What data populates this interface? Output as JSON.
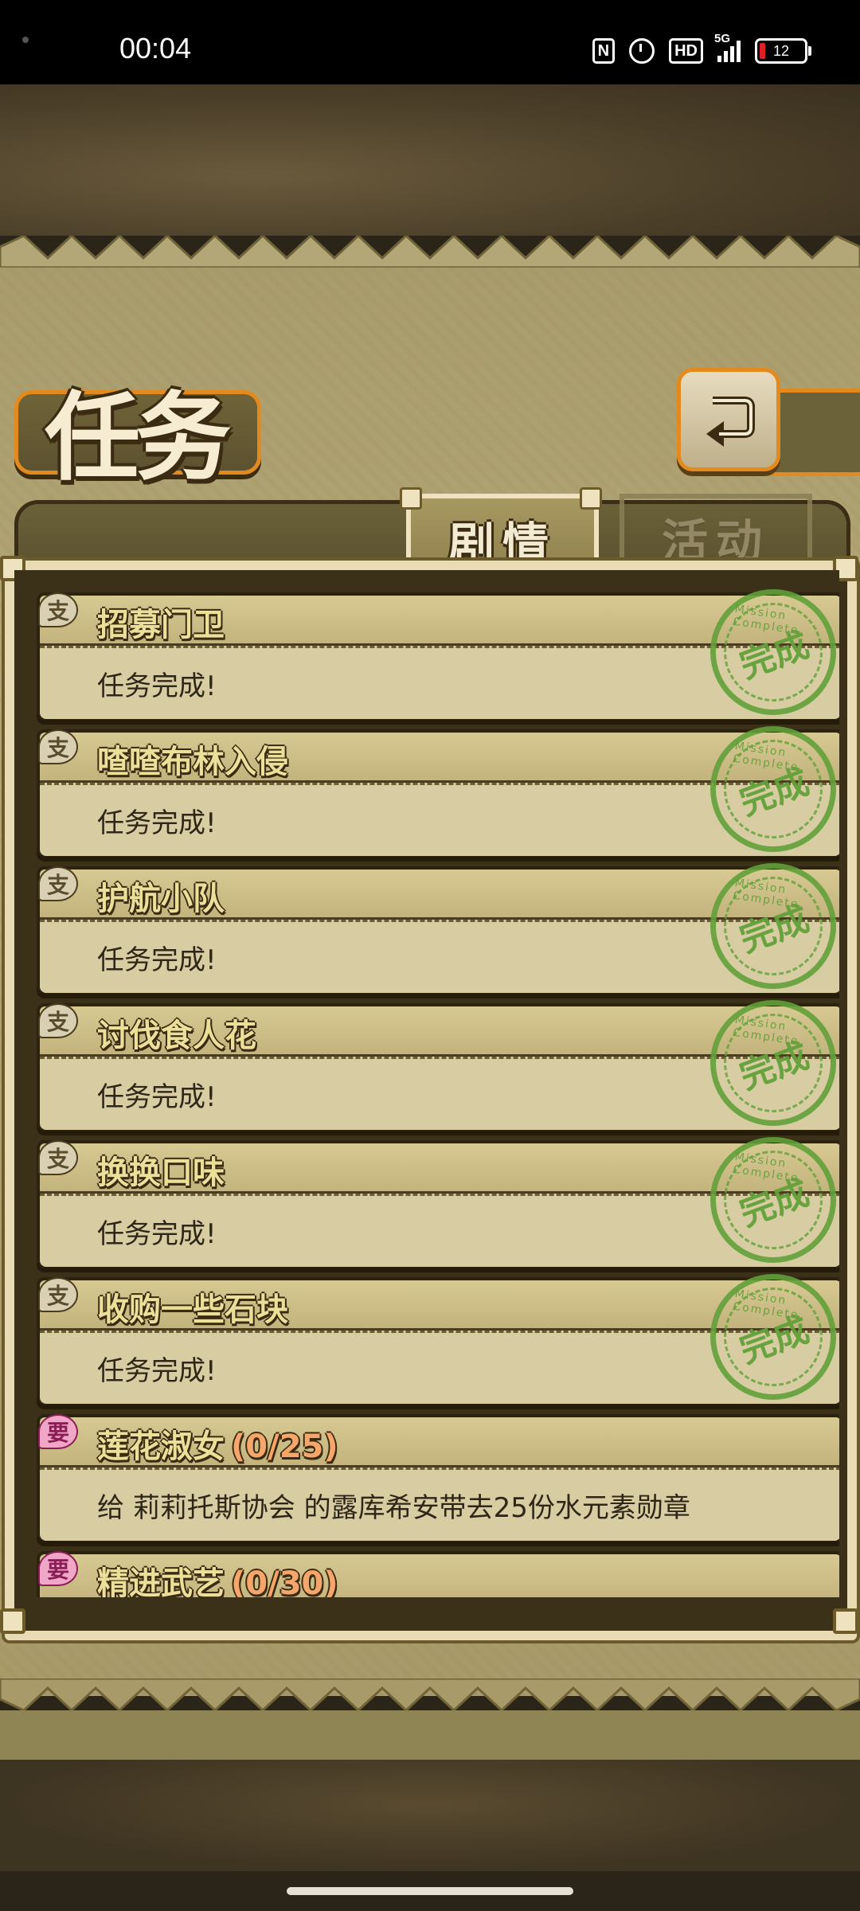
{
  "status_bar": {
    "time": "00:04",
    "network": "5G",
    "hd_label": "HD",
    "battery": "12"
  },
  "header": {
    "title": "任务",
    "back_icon": "return-arrow-icon"
  },
  "tabs": [
    {
      "label": "剧情",
      "active": true
    },
    {
      "label": "活动",
      "active": false
    }
  ],
  "quests": [
    {
      "badge": "支",
      "type": "side",
      "title": "招募门卫",
      "progress": "",
      "desc": "任务完成!",
      "completed": true
    },
    {
      "badge": "支",
      "type": "side",
      "title": "喳喳布林入侵",
      "progress": "",
      "desc": "任务完成!",
      "completed": true
    },
    {
      "badge": "支",
      "type": "side",
      "title": "护航小队",
      "progress": "",
      "desc": "任务完成!",
      "completed": true
    },
    {
      "badge": "支",
      "type": "side",
      "title": "讨伐食人花",
      "progress": "",
      "desc": "任务完成!",
      "completed": true
    },
    {
      "badge": "支",
      "type": "side",
      "title": "换换口味",
      "progress": "",
      "desc": "任务完成!",
      "completed": true
    },
    {
      "badge": "支",
      "type": "side",
      "title": "收购一些石块",
      "progress": "",
      "desc": "任务完成!",
      "completed": true
    },
    {
      "badge": "要",
      "type": "main",
      "title": "莲花淑女",
      "progress": "(0/25)",
      "desc": "给 莉莉托斯协会 的露库希安带去25份水元素勋章",
      "completed": false
    },
    {
      "badge": "要",
      "type": "main",
      "title": "精进武艺",
      "progress": "(0/30)",
      "desc": "",
      "completed": false
    }
  ],
  "stamp": {
    "label": "完成",
    "ring_text": "Mission Complete",
    "color": "#62a03a"
  },
  "colors": {
    "accent_orange": "#e38a1f",
    "parchment": "#b3a677",
    "progress": "#f6a66a"
  }
}
